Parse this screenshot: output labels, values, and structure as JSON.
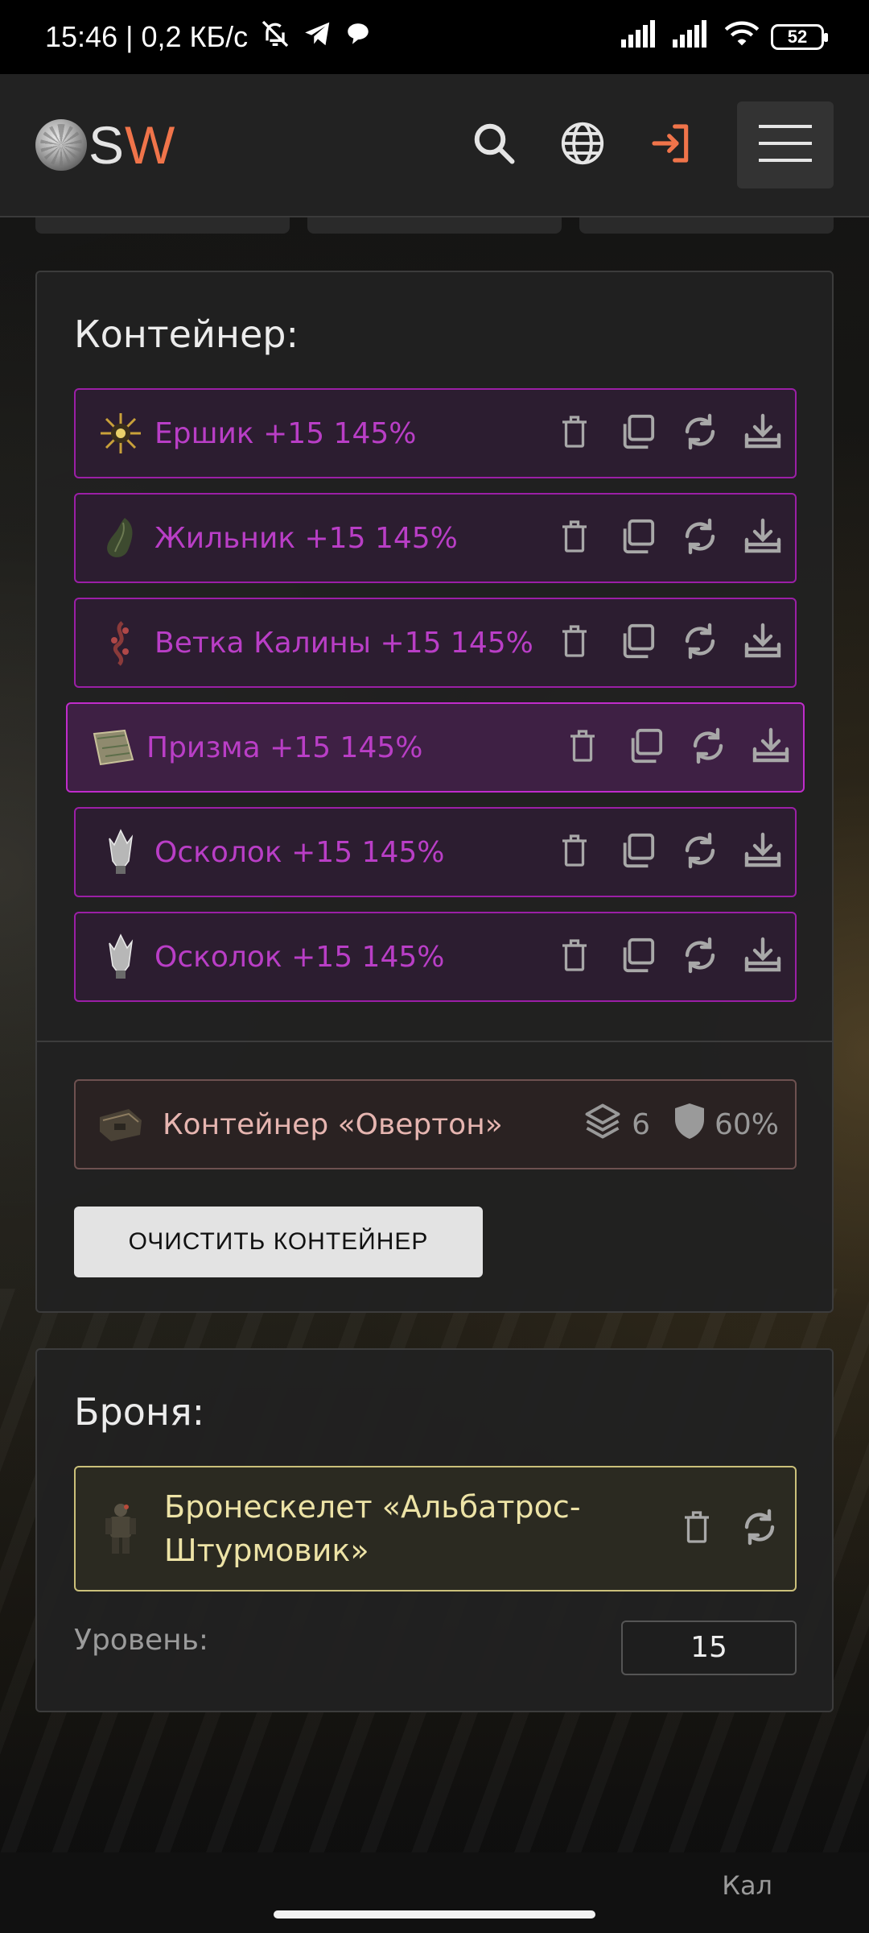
{
  "status_bar": {
    "time_speed": "15:46 | 0,2 КБ/с",
    "battery": "52"
  },
  "header": {
    "logo": {
      "s": "S",
      "w": "W"
    },
    "icons": [
      "search-icon",
      "globe-icon",
      "login-icon",
      "menu-icon"
    ],
    "colors": {
      "accent": "#f0744a"
    }
  },
  "container_panel": {
    "title": "Контейнер:",
    "items": [
      {
        "name": "Ершик +15 145%",
        "icon": "urchin-artifact-icon"
      },
      {
        "name": "Жильник +15 145%",
        "icon": "vein-artifact-icon"
      },
      {
        "name": "Ветка Калины +15 145%",
        "icon": "viburnum-branch-icon"
      },
      {
        "name": "Призма +15 145%",
        "icon": "prism-artifact-icon"
      },
      {
        "name": "Осколок +15 145%",
        "icon": "shard-artifact-icon"
      },
      {
        "name": "Осколок +15 145%",
        "icon": "shard-artifact-icon"
      }
    ],
    "item_color": "#b93ec6",
    "container": {
      "name": "Контейнер «Овертон»",
      "slots": "6",
      "protection": "60%"
    },
    "clear_button": "ОЧИСТИТЬ КОНТЕЙНЕР"
  },
  "armor_panel": {
    "title": "Броня:",
    "armor": {
      "line1": "Бронескелет «Альбатрос-",
      "line2": "Штурмовик»"
    },
    "level_label": "Уровень:",
    "level_value": "15"
  },
  "bottom": {
    "text": "Кал"
  }
}
